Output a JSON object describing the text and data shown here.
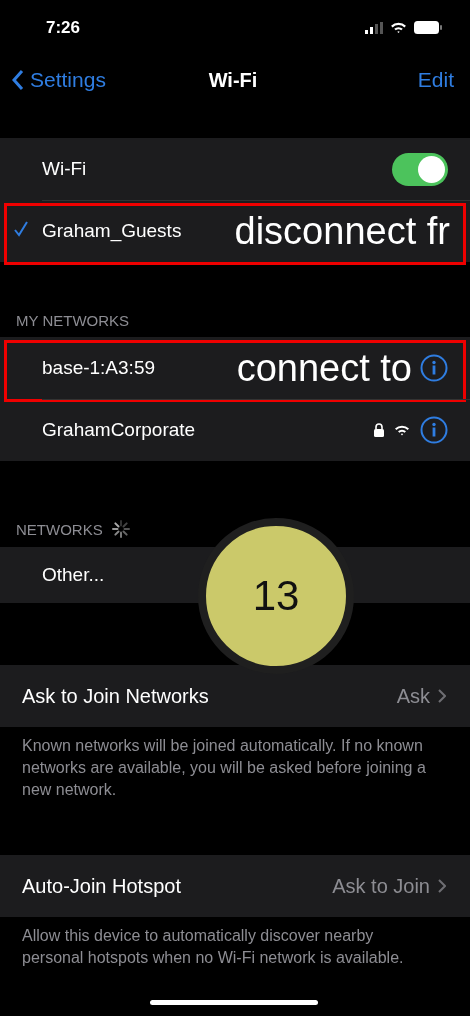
{
  "status_bar": {
    "time": "7:26"
  },
  "nav": {
    "back": "Settings",
    "title": "Wi-Fi",
    "action": "Edit"
  },
  "wifi_toggle": {
    "label": "Wi-Fi",
    "on": true
  },
  "current_network": {
    "name": "Graham_Guests",
    "connected": true,
    "annotation": "disconnect fr"
  },
  "my_networks": {
    "header": "MY NETWORKS",
    "items": [
      {
        "name": "base-1:A3:59",
        "annotation": "connect to"
      },
      {
        "name": "GrahamCorporate",
        "locked": true
      }
    ]
  },
  "networks": {
    "header": "NETWORKS",
    "loading": true,
    "items": [
      {
        "name": "Other..."
      }
    ]
  },
  "settings": [
    {
      "label": "Ask to Join Networks",
      "value": "Ask",
      "footnote": "Known networks will be joined automatically. If no known networks are available, you will be asked before joining a new network."
    },
    {
      "label": "Auto-Join Hotspot",
      "value": "Ask to Join",
      "footnote": "Allow this device to automatically discover nearby personal hotspots when no Wi-Fi network is available."
    }
  ],
  "step_badge": "13"
}
